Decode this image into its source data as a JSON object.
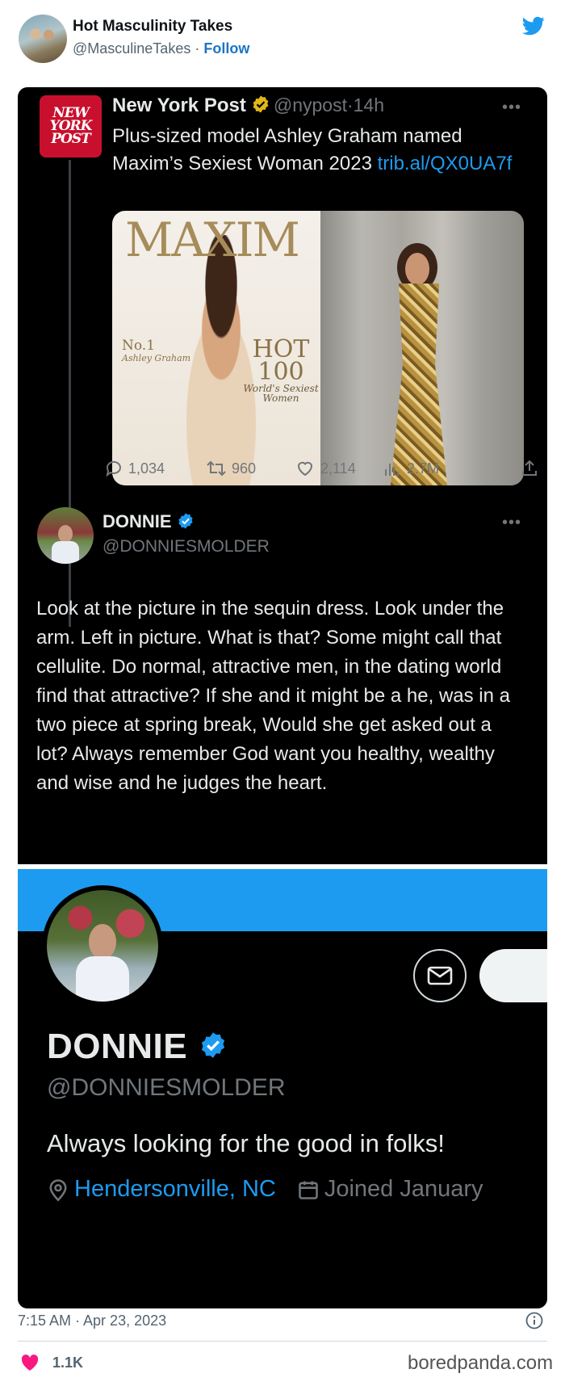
{
  "embed": {
    "account_name": "Hot Masculinity Takes",
    "account_handle": "@MasculineTakes",
    "separator": "·",
    "follow_label": "Follow",
    "timestamp": "7:15 AM · Apr 23, 2023",
    "likes_count": "1.1K",
    "watermark": "boredpanda.com"
  },
  "quoted_tweet": {
    "logo_lines": [
      "NEW",
      "YORK",
      "POST"
    ],
    "author_name": "New York Post",
    "author_handle": "@nypost",
    "age": "14h",
    "text": "Plus-sized model Ashley Graham named Maxim’s Sexiest Woman 2023",
    "link": "trib.al/QX0UA7f",
    "cover": {
      "masthead": "MAXIM",
      "no1_label": "No.1",
      "no1_name": "Ashley Graham",
      "hot_label": "HOT 100",
      "hot_sub": "World's Sexiest Women"
    },
    "stats": {
      "replies": "1,034",
      "retweets": "960",
      "likes": "2,114",
      "views": "2.7M"
    }
  },
  "reply": {
    "author_name": "DONNIE",
    "author_handle": "@DONNIESMOLDER",
    "text": "Look at the picture in the sequin dress. Look under the arm.  Left in picture.  What is that? Some might call that cellulite.  Do normal, attractive men, in the dating world find that attractive? If she and it might be a he, was in a two piece at spring break, Would she get asked out a lot? Always remember God want you healthy, wealthy and wise and he judges the heart."
  },
  "profile": {
    "name": "DONNIE",
    "handle": "@DONNIESMOLDER",
    "bio": "Always looking for the good in folks!",
    "location": "Hendersonville, NC",
    "joined": "Joined January"
  },
  "colors": {
    "twitter_blue": "#1d9bf0",
    "follow_link": "#1d74c4",
    "nypost_red": "#c8102e",
    "like_pink": "#f91880",
    "gold_badge": "#e2b719"
  },
  "icons": [
    "twitter-bird-icon",
    "verified-gold-icon",
    "verified-blue-icon",
    "more-icon",
    "reply-icon",
    "retweet-icon",
    "like-icon",
    "views-icon",
    "share-icon",
    "mail-icon",
    "location-icon",
    "calendar-icon",
    "info-icon",
    "heart-icon"
  ]
}
